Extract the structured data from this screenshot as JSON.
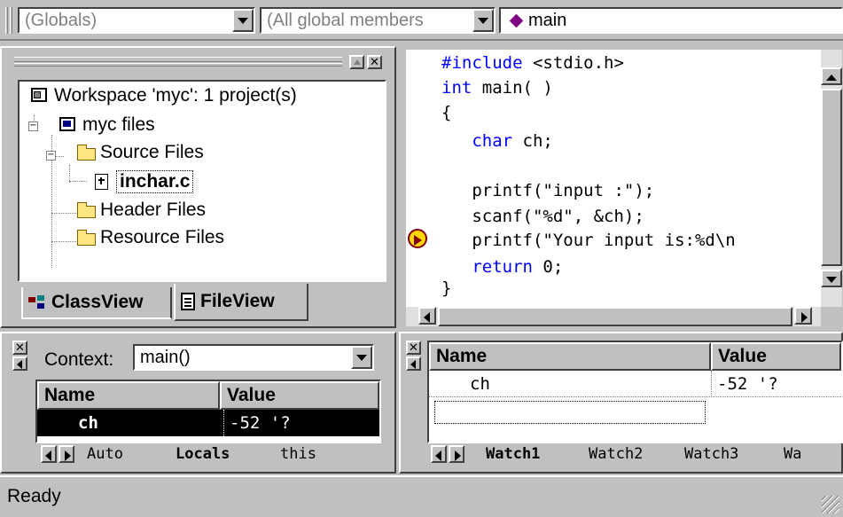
{
  "toolbar": {
    "globals_combo": "(Globals)",
    "members_combo": "(All global members",
    "function_combo": "main"
  },
  "workspace": {
    "tree": [
      {
        "label": "Workspace 'myc': 1 project(s)"
      },
      {
        "label": "myc files"
      },
      {
        "label": "Source Files"
      },
      {
        "label": "inchar.c"
      },
      {
        "label": "Header Files"
      },
      {
        "label": "Resource Files"
      }
    ],
    "tabs": [
      {
        "label": "ClassView"
      },
      {
        "label": "FileView"
      }
    ]
  },
  "editor": {
    "lines": [
      {
        "kw": "#include",
        "rest": " <stdio.h>"
      },
      {
        "kw": "int",
        "rest": " main( )"
      },
      {
        "kw": "",
        "rest": "{"
      },
      {
        "kw": "   char",
        "rest": " ch;"
      },
      {
        "kw": "",
        "rest": ""
      },
      {
        "kw": "",
        "rest": "   printf(\"input :\");"
      },
      {
        "kw": "",
        "rest": "   scanf(\"%d\", &ch);"
      },
      {
        "kw": "",
        "rest": "   printf(\"Your input is:%d\\n"
      },
      {
        "kw": "   return",
        "rest": " 0;"
      },
      {
        "kw": "",
        "rest": "}"
      }
    ]
  },
  "variables": {
    "context_label": "Context:",
    "context_value": "main()",
    "headers": {
      "name": "Name",
      "value": "Value"
    },
    "rows": [
      {
        "name": "ch",
        "value": "-52 '?"
      }
    ],
    "tabs": [
      {
        "label": "Auto"
      },
      {
        "label": "Locals"
      },
      {
        "label": "this"
      }
    ]
  },
  "watch": {
    "headers": {
      "name": "Name",
      "value": "Value"
    },
    "rows": [
      {
        "name": "ch",
        "value": "-52 '?"
      }
    ],
    "tabs": [
      {
        "label": "Watch1"
      },
      {
        "label": "Watch2"
      },
      {
        "label": "Watch3"
      },
      {
        "label": "Wa"
      }
    ]
  },
  "status": {
    "text": "Ready"
  }
}
